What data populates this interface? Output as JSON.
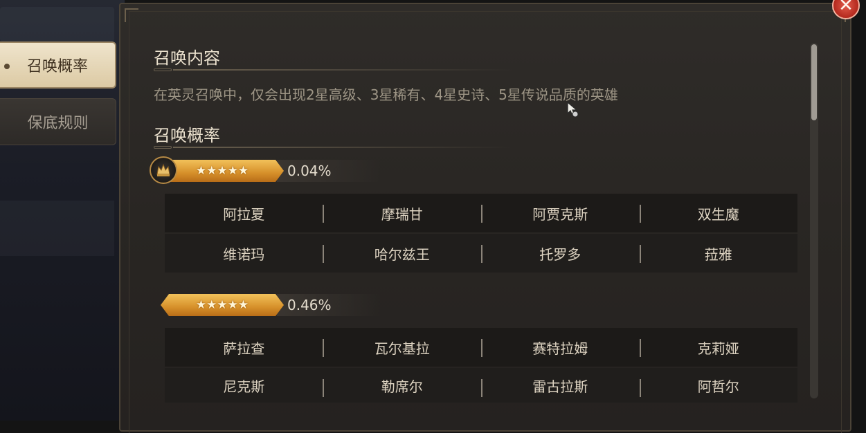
{
  "tabs": [
    {
      "label": "召唤概率",
      "active": true
    },
    {
      "label": "保底规则",
      "active": false
    }
  ],
  "close_icon": "close-icon",
  "sections": {
    "content_title": "召唤内容",
    "content_desc": "在英灵召唤中，仅会出现2星高级、3星稀有、4星史诗、5星传说品质的英雄",
    "prob_title": "召唤概率"
  },
  "tiers": [
    {
      "stars": "★★★★★",
      "probability": "0.04%",
      "heroes": [
        [
          "阿拉夏",
          "摩瑞甘",
          "阿贾克斯",
          "双生魔"
        ],
        [
          "维诺玛",
          "哈尔兹王",
          "托罗多",
          "菈雅"
        ]
      ]
    },
    {
      "stars": "★★★★★",
      "probability": "0.46%",
      "heroes": [
        [
          "萨拉查",
          "瓦尔基拉",
          "赛特拉姆",
          "克莉娅"
        ],
        [
          "尼克斯",
          "勒席尔",
          "雷古拉斯",
          "阿哲尔"
        ]
      ]
    }
  ],
  "colors": {
    "gold": "#d6902a",
    "close": "#b3281d",
    "tab_active": "#e6d8b8"
  }
}
